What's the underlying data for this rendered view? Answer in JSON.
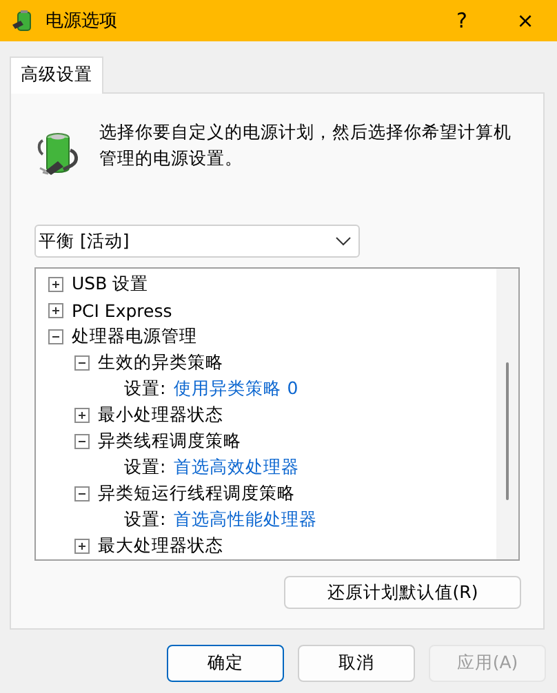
{
  "window": {
    "title": "电源选项",
    "help": "?",
    "close": "×"
  },
  "tabs": [
    {
      "label": "高级设置",
      "selected": true
    }
  ],
  "description": "选择你要自定义的电源计划，然后选择你希望计算机管理的电源设置。",
  "plan_dropdown": {
    "value": "平衡 [活动]"
  },
  "tree": [
    {
      "kind": "group",
      "label": "USB 设置",
      "expanded": false
    },
    {
      "kind": "group",
      "label": "PCI Express",
      "expanded": false
    },
    {
      "kind": "group",
      "label": "处理器电源管理",
      "expanded": true,
      "children": [
        {
          "kind": "group",
          "label": "生效的异类策略",
          "expanded": true,
          "children": [
            {
              "kind": "setting",
              "label": "设置:",
              "value": "使用异类策略 0"
            }
          ]
        },
        {
          "kind": "group",
          "label": "最小处理器状态",
          "expanded": false
        },
        {
          "kind": "group",
          "label": "异类线程调度策略",
          "expanded": true,
          "children": [
            {
              "kind": "setting",
              "label": "设置:",
              "value": "首选高效处理器"
            }
          ]
        },
        {
          "kind": "group",
          "label": "异类短运行线程调度策略",
          "expanded": true,
          "children": [
            {
              "kind": "setting",
              "label": "设置:",
              "value": "首选高性能处理器"
            }
          ]
        },
        {
          "kind": "group",
          "label": "最大处理器状态",
          "expanded": false
        }
      ]
    }
  ],
  "restore_button": "还原计划默认值(R)",
  "buttons": [
    {
      "label": "确定",
      "kind": "default",
      "disabled": false
    },
    {
      "label": "取消",
      "kind": "normal",
      "disabled": false
    },
    {
      "label": "应用(A)",
      "kind": "normal",
      "disabled": true
    }
  ]
}
